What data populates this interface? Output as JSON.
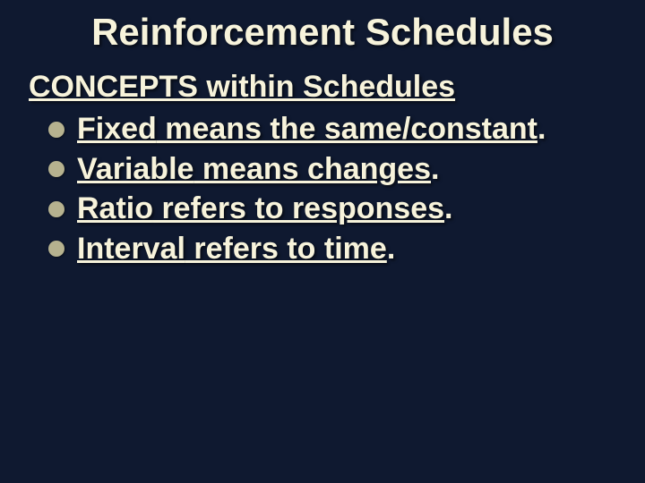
{
  "title": "Reinforcement Schedules",
  "subtitle": "CONCEPTS within Schedules",
  "bullets": [
    {
      "term": "Fixed",
      "mid": " means the same/constant",
      "end": "."
    },
    {
      "term": "Variable",
      "mid": " means changes",
      "end": "."
    },
    {
      "term": "Ratio",
      "mid": " refers to responses",
      "end": "."
    },
    {
      "term": "Interval",
      "mid": " refers to time",
      "end": "."
    }
  ]
}
